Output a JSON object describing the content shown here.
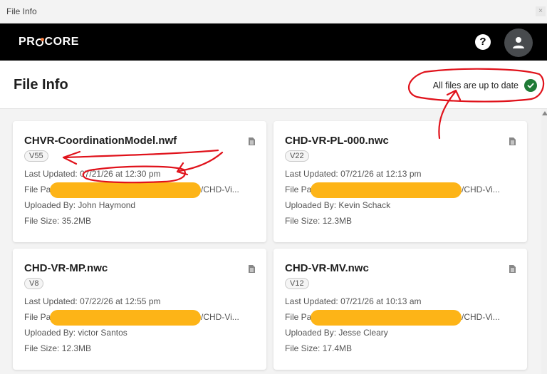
{
  "window": {
    "title": "File Info",
    "close_glyph": "×"
  },
  "appbar": {
    "logo": "PROCORE",
    "help_icon": "question-circle-icon",
    "avatar_icon": "user-icon"
  },
  "header": {
    "title": "File Info",
    "status_text": "All files are up to date",
    "status_icon": "check-circle-icon",
    "status_color": "#1f7a36"
  },
  "files": [
    {
      "name": "CHVR-CoordinationModel.nwf",
      "version": "V55",
      "last_updated_label": "Last Updated:",
      "last_updated": "07/21/26 at 12:30 pm",
      "path_label": "File Path",
      "path_tail": "/CHD-Vi...",
      "uploaded_label": "Uploaded By:",
      "uploaded_by": "John Haymond",
      "size_label": "File Size:",
      "size": "35.2MB"
    },
    {
      "name": "CHD-VR-PL-000.nwc",
      "version": "V22",
      "last_updated_label": "Last Updated:",
      "last_updated": "07/21/26 at 12:13 pm",
      "path_label": "File Path",
      "path_tail": "/CHD-Vi...",
      "uploaded_label": "Uploaded By:",
      "uploaded_by": "Kevin Schack",
      "size_label": "File Size:",
      "size": "12.3MB"
    },
    {
      "name": "CHD-VR-MP.nwc",
      "version": "V8",
      "last_updated_label": "Last Updated:",
      "last_updated": "07/22/26 at 12:55 pm",
      "path_label": "File Path",
      "path_tail": "/CHD-Vi...",
      "uploaded_label": "Uploaded By:",
      "uploaded_by": "victor Santos",
      "size_label": "File Size:",
      "size": "12.3MB"
    },
    {
      "name": "CHD-VR-MV.nwc",
      "version": "V12",
      "last_updated_label": "Last Updated:",
      "last_updated": "07/21/26 at 10:13 am",
      "path_label": "File Path",
      "path_tail": "/CHD-Vi...",
      "uploaded_label": "Uploaded By:",
      "uploaded_by": "Jesse Cleary",
      "size_label": "File Size:",
      "size": "17.4MB"
    }
  ],
  "colors": {
    "appbar": "#000000",
    "redaction": "#fdb417",
    "annotation": "#e0121b",
    "content_bg": "#f3f3f3"
  }
}
